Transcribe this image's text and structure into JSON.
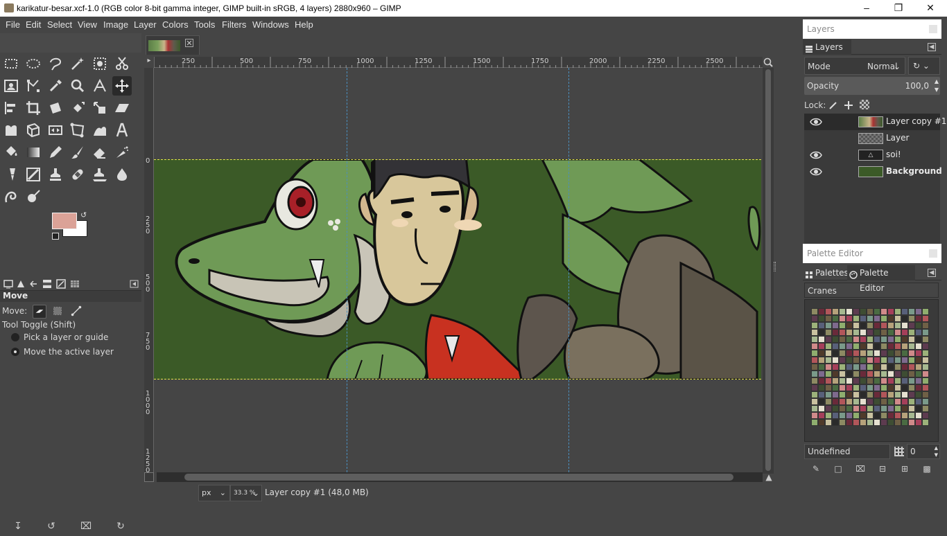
{
  "window": {
    "title": "karikatur-besar.xcf-1.0 (RGB color 8-bit gamma integer, GIMP built-in sRGB, 4 layers) 2880x960 – GIMP"
  },
  "menu": [
    "File",
    "Edit",
    "Select",
    "View",
    "Image",
    "Layer",
    "Colors",
    "Tools",
    "Filters",
    "Windows",
    "Help"
  ],
  "tool_options": {
    "title": "Move",
    "move_label": "Move:",
    "toggle_label": "Tool Toggle  (Shift)",
    "options": [
      "Pick a layer or guide",
      "Move the active layer"
    ],
    "selected_option": 1
  },
  "colors": {
    "foreground": "#dba297",
    "background": "#ffffff",
    "canvas_green": "#3b5a27",
    "guide": "#4a8fbf"
  },
  "ruler": {
    "h_labels": [
      "250",
      "500",
      "750",
      "1000",
      "1250",
      "1500",
      "1750",
      "2000",
      "2250",
      "2500"
    ],
    "v_labels": [
      "0",
      "2 5 0",
      "5 0 0",
      "7 5 0",
      "1 0 0 0",
      "1 2 5 0"
    ]
  },
  "status": {
    "unit": "px",
    "zoom": "33.3 %",
    "message": "Layer copy #1 (48,0 MB)"
  },
  "layers_dock": {
    "header": "Layers",
    "tab": "Layers",
    "mode_label": "Mode",
    "mode_value": "Normal",
    "opacity_label": "Opacity",
    "opacity_value": "100,0",
    "lock_label": "Lock:",
    "items": [
      {
        "name": "Layer copy #1",
        "visible": true,
        "bold": false,
        "selected": true
      },
      {
        "name": "Layer",
        "visible": false,
        "bold": false,
        "selected": false
      },
      {
        "name": "soi!",
        "visible": true,
        "bold": false,
        "selected": false
      },
      {
        "name": "Background",
        "visible": true,
        "bold": true,
        "selected": false
      }
    ]
  },
  "palette_dock": {
    "header": "Palette Editor",
    "tabs": [
      "Palettes",
      "Palette Editor"
    ],
    "palette_name": "Cranes",
    "entry_name": "Undefined",
    "columns_value": "0"
  }
}
